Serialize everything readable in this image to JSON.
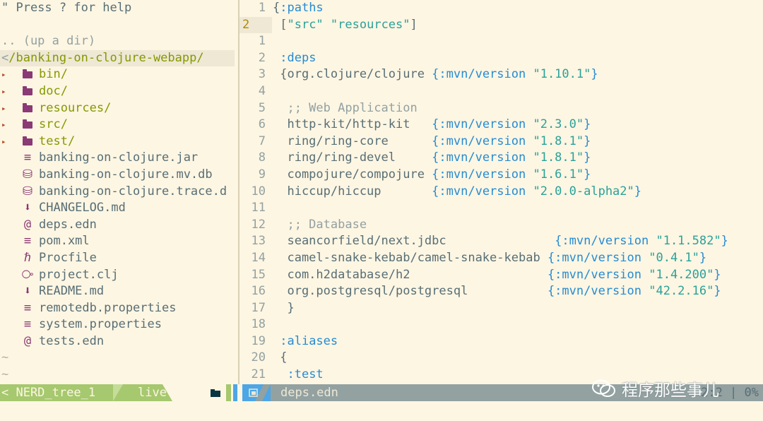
{
  "tree": {
    "help_text": "\" Press ? for help",
    "up_dir": ".. (up a dir)",
    "root_prefix": "<",
    "root_path": "/banking-on-clojure-webapp/",
    "items": [
      {
        "name": "bin/",
        "type": "dir",
        "icon": "folder-icon"
      },
      {
        "name": "doc/",
        "type": "dir",
        "icon": "folder-icon"
      },
      {
        "name": "resources/",
        "type": "dir",
        "icon": "folder-icon"
      },
      {
        "name": "src/",
        "type": "dir",
        "icon": "folder-icon"
      },
      {
        "name": "test/",
        "type": "dir",
        "icon": "folder-icon"
      },
      {
        "name": "banking-on-clojure.jar",
        "type": "file",
        "icon": "lines-icon"
      },
      {
        "name": "banking-on-clojure.mv.db",
        "type": "file",
        "icon": "database-icon"
      },
      {
        "name": "banking-on-clojure.trace.d",
        "type": "file",
        "icon": "database-icon"
      },
      {
        "name": "CHANGELOG.md",
        "type": "file",
        "icon": "markdown-icon"
      },
      {
        "name": "deps.edn",
        "type": "file",
        "icon": "edn-icon"
      },
      {
        "name": "pom.xml",
        "type": "file",
        "icon": "lines-icon"
      },
      {
        "name": "Procfile",
        "type": "file",
        "icon": "heroku-icon"
      },
      {
        "name": "project.clj",
        "type": "file",
        "icon": "clojure-icon"
      },
      {
        "name": "README.md",
        "type": "file",
        "icon": "markdown-icon"
      },
      {
        "name": "remotedb.properties",
        "type": "file",
        "icon": "lines-icon"
      },
      {
        "name": "system.properties",
        "type": "file",
        "icon": "lines-icon"
      },
      {
        "name": "tests.edn",
        "type": "file",
        "icon": "edn-icon"
      }
    ],
    "tildes": [
      "~",
      "~"
    ]
  },
  "editor": {
    "lines": [
      {
        "num": "1",
        "code": [
          [
            "pl",
            "{"
          ],
          [
            "kw",
            ":paths"
          ]
        ]
      },
      {
        "num": "2",
        "current": true,
        "code": [
          [
            "pl",
            " ["
          ],
          [
            "str",
            "\"src\""
          ],
          [
            "pl",
            " "
          ],
          [
            "str",
            "\"resources\""
          ],
          [
            "pl",
            "]"
          ]
        ]
      },
      {
        "num": "1",
        "code": []
      },
      {
        "num": "2",
        "code": [
          [
            "pl",
            " "
          ],
          [
            "kw",
            ":deps"
          ]
        ]
      },
      {
        "num": "3",
        "code": [
          [
            "pl",
            " {org.clojure/clojure "
          ],
          [
            "kw",
            "{:mvn/version "
          ],
          [
            "str",
            "\"1.10.1\""
          ],
          [
            "kw",
            "}"
          ]
        ]
      },
      {
        "num": "4",
        "code": []
      },
      {
        "num": "5",
        "code": [
          [
            "cmt",
            "  ;; Web Application"
          ]
        ]
      },
      {
        "num": "6",
        "code": [
          [
            "pl",
            "  http-kit/http-kit   "
          ],
          [
            "kw",
            "{:mvn/version "
          ],
          [
            "str",
            "\"2.3.0\""
          ],
          [
            "kw",
            "}"
          ]
        ]
      },
      {
        "num": "7",
        "code": [
          [
            "pl",
            "  ring/ring-core      "
          ],
          [
            "kw",
            "{:mvn/version "
          ],
          [
            "str",
            "\"1.8.1\""
          ],
          [
            "kw",
            "}"
          ]
        ]
      },
      {
        "num": "8",
        "code": [
          [
            "pl",
            "  ring/ring-devel     "
          ],
          [
            "kw",
            "{:mvn/version "
          ],
          [
            "str",
            "\"1.8.1\""
          ],
          [
            "kw",
            "}"
          ]
        ]
      },
      {
        "num": "9",
        "code": [
          [
            "pl",
            "  compojure/compojure "
          ],
          [
            "kw",
            "{:mvn/version "
          ],
          [
            "str",
            "\"1.6.1\""
          ],
          [
            "kw",
            "}"
          ]
        ]
      },
      {
        "num": "10",
        "code": [
          [
            "pl",
            "  hiccup/hiccup       "
          ],
          [
            "kw",
            "{:mvn/version "
          ],
          [
            "str",
            "\"2.0.0-alpha2\""
          ],
          [
            "kw",
            "}"
          ]
        ]
      },
      {
        "num": "11",
        "code": []
      },
      {
        "num": "12",
        "code": [
          [
            "cmt",
            "  ;; Database"
          ]
        ]
      },
      {
        "num": "13",
        "code": [
          [
            "pl",
            "  seancorfield/next.jdbc               "
          ],
          [
            "kw",
            "{:mvn/version "
          ],
          [
            "str",
            "\"1.1.582\""
          ],
          [
            "kw",
            "}"
          ]
        ]
      },
      {
        "num": "14",
        "code": [
          [
            "pl",
            "  camel-snake-kebab/camel-snake-kebab "
          ],
          [
            "kw",
            "{:mvn/version "
          ],
          [
            "str",
            "\"0.4.1\""
          ],
          [
            "kw",
            "}"
          ]
        ]
      },
      {
        "num": "15",
        "code": [
          [
            "pl",
            "  com.h2database/h2                   "
          ],
          [
            "kw",
            "{:mvn/version "
          ],
          [
            "str",
            "\"1.4.200\""
          ],
          [
            "kw",
            "}"
          ]
        ]
      },
      {
        "num": "16",
        "code": [
          [
            "pl",
            "  org.postgresql/postgresql           "
          ],
          [
            "kw",
            "{:mvn/version "
          ],
          [
            "str",
            "\"42.2.16\""
          ],
          [
            "kw",
            "}"
          ]
        ]
      },
      {
        "num": "17",
        "code": [
          [
            "pl",
            "  }"
          ]
        ]
      },
      {
        "num": "18",
        "code": []
      },
      {
        "num": "19",
        "code": [
          [
            "pl",
            " "
          ],
          [
            "kw",
            ":aliases"
          ]
        ]
      },
      {
        "num": "20",
        "code": [
          [
            "pl",
            " {"
          ]
        ]
      },
      {
        "num": "21",
        "code": [
          [
            "pl",
            "  "
          ],
          [
            "kw",
            ":test"
          ]
        ]
      }
    ]
  },
  "status": {
    "nerd_label": "< NERD_tree_1",
    "branch_label": "live",
    "file_name": "deps.edn",
    "position": "2:2 | 0%",
    "colors": {
      "accent_green": "#a6c86e",
      "accent_blue": "#4da6e6",
      "bar": "#93a1a1"
    }
  },
  "watermark": {
    "text": "程序那些事儿",
    "icon": "wechat-icon"
  }
}
